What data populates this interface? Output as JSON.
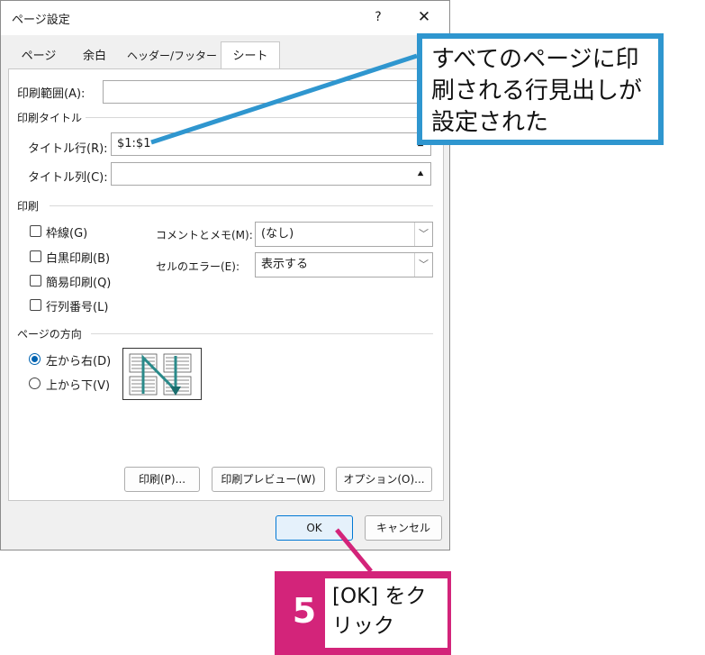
{
  "dialog": {
    "title": "ページ設定",
    "help_label": "?",
    "close_label": "✕",
    "tabs": [
      {
        "label": "ページ"
      },
      {
        "label": "余白"
      },
      {
        "label": "ヘッダー/フッター"
      },
      {
        "label": "シート"
      }
    ],
    "print_area": {
      "label": "印刷範囲(A):",
      "value": ""
    },
    "print_titles": {
      "group": "印刷タイトル",
      "rows_label": "タイトル行(R):",
      "rows_value": "$1:$1",
      "cols_label": "タイトル列(C):",
      "cols_value": ""
    },
    "print": {
      "group": "印刷",
      "checkboxes": [
        {
          "label": "枠線(G)"
        },
        {
          "label": "白黒印刷(B)"
        },
        {
          "label": "簡易印刷(Q)"
        },
        {
          "label": "行列番号(L)"
        }
      ],
      "comments_label": "コメントとメモ(M):",
      "comments_value": "(なし)",
      "errors_label": "セルのエラー(E):",
      "errors_value": "表示する"
    },
    "order": {
      "group": "ページの方向",
      "options": [
        {
          "label": "左から右(D)",
          "checked": true
        },
        {
          "label": "上から下(V)",
          "checked": false
        }
      ]
    },
    "buttons": {
      "print": "印刷(P)...",
      "preview": "印刷プレビュー(W)",
      "options": "オプション(O)...",
      "ok": "OK",
      "cancel": "キャンセル"
    }
  },
  "annotations": {
    "callout_blue": "すべてのページに印刷される行見出しが設定された",
    "callout_step": {
      "number": "5",
      "text": "[OK] をクリック"
    },
    "colors": {
      "blue": "#2f96cf",
      "pink": "#d3247a"
    }
  }
}
